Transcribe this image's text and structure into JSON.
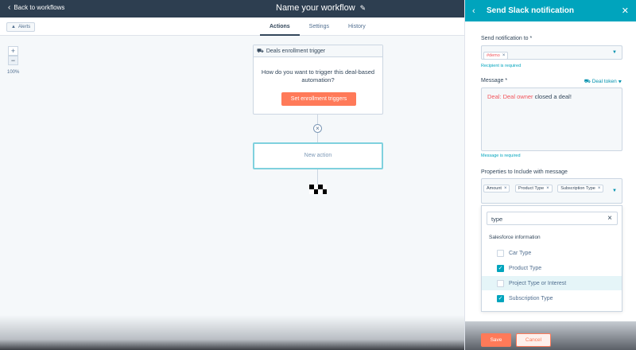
{
  "topbar": {
    "back_label": "Back to workflows",
    "title": "Name your workflow"
  },
  "toolbar": {
    "alerts_label": "Alerts"
  },
  "tabs": [
    {
      "label": "Actions",
      "active": true
    },
    {
      "label": "Settings"
    },
    {
      "label": "History"
    }
  ],
  "zoom": {
    "plus": "+",
    "minus": "−",
    "level": "100%"
  },
  "trigger": {
    "title": "Deals enrollment trigger",
    "question": "How do you want to trigger this deal-based automation?",
    "button": "Set enrollment triggers"
  },
  "new_action_label": "New action",
  "panel": {
    "title": "Send Slack notification",
    "recipient_label": "Send notification to *",
    "recipient_chip": "#demo",
    "recipient_error": "Recipient is required",
    "message_label": "Message *",
    "deal_token": "Deal token",
    "message_token": "Deal: Deal owner",
    "message_text": "closed a deal!",
    "message_error": "Message is required",
    "properties_label": "Properties to Include with message",
    "property_chips": [
      "Amount",
      "Product Type",
      "Subscription Type"
    ],
    "search_value": "type",
    "group_label": "Salesforce information",
    "options": [
      {
        "label": "Car Type",
        "checked": false
      },
      {
        "label": "Product Type",
        "checked": true
      },
      {
        "label": "Project Type or Interest",
        "checked": false
      },
      {
        "label": "Subscription Type",
        "checked": true
      }
    ],
    "save_label": "Save",
    "cancel_label": "Cancel"
  },
  "colors": {
    "accent": "#00a4bd",
    "brand": "#ff7a59",
    "nav": "#2d3e50",
    "error": "#f2545b"
  }
}
